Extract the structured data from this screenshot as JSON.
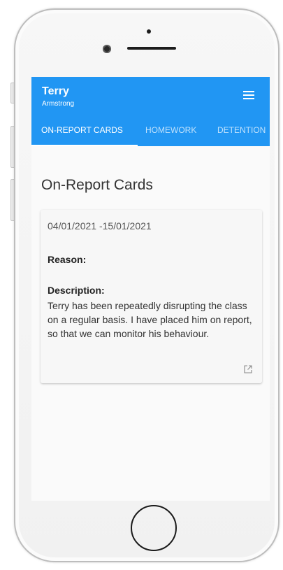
{
  "student": {
    "first_name": "Terry",
    "last_name": "Armstrong"
  },
  "tabs": [
    {
      "label": "ON-REPORT CARDS",
      "active": true
    },
    {
      "label": "HOMEWORK",
      "active": false
    },
    {
      "label": "DETENTION",
      "active": false
    }
  ],
  "page_title": "On-Report Cards",
  "card": {
    "date_range": "04/01/2021 -15/01/2021",
    "reason_label": "Reason:",
    "description_label": "Description:",
    "description_text": "Terry has been repeatedly disrupting the class on a regular basis. I have placed him on report, so that we can monitor his behaviour."
  },
  "icons": {
    "menu": "hamburger-menu-icon",
    "open": "open-in-new-icon"
  },
  "colors": {
    "appbar": "#2196f3"
  }
}
